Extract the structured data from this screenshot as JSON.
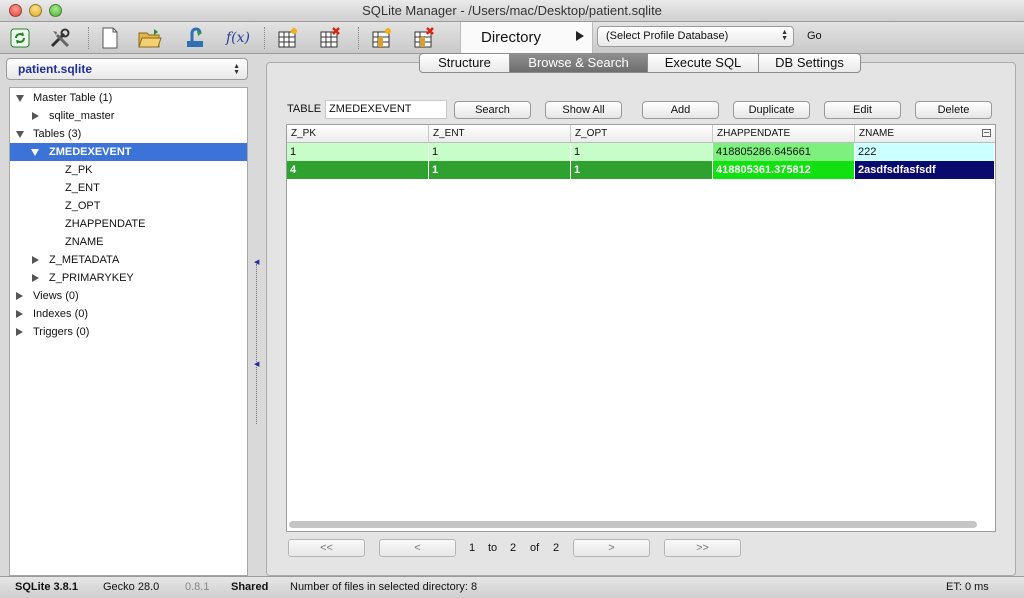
{
  "window": {
    "title": "SQLite Manager - /Users/mac/Desktop/patient.sqlite"
  },
  "toolbar": {
    "icons": [
      "refresh-icon",
      "tools-icon",
      "new-database-icon",
      "open-database-icon",
      "connect-icon",
      "function-icon",
      "create-table-icon",
      "drop-table-icon",
      "create-index-icon",
      "drop-index-icon"
    ],
    "function_label": "f(x)",
    "directory_label": "Directory",
    "profile_select": "(Select Profile Database)",
    "go_label": "Go"
  },
  "sidebar": {
    "database": "patient.sqlite",
    "tree": [
      {
        "label": "Master Table (1)",
        "state": "open"
      },
      {
        "label": "sqlite_master",
        "state": "closed"
      },
      {
        "label": "Tables (3)",
        "state": "open"
      },
      {
        "label": "ZMEDEXEVENT",
        "state": "open",
        "selected": true
      },
      {
        "label": "Z_PK"
      },
      {
        "label": "Z_ENT"
      },
      {
        "label": "Z_OPT"
      },
      {
        "label": "ZHAPPENDATE"
      },
      {
        "label": "ZNAME"
      },
      {
        "label": "Z_METADATA",
        "state": "closed"
      },
      {
        "label": "Z_PRIMARYKEY",
        "state": "closed"
      },
      {
        "label": "Views (0)",
        "state": "closed"
      },
      {
        "label": "Indexes (0)",
        "state": "closed"
      },
      {
        "label": "Triggers (0)",
        "state": "closed"
      }
    ]
  },
  "tabs": {
    "structure": "Structure",
    "browse": "Browse & Search",
    "execute": "Execute SQL",
    "settings": "DB Settings"
  },
  "browse": {
    "table_label": "TABLE",
    "table_name": "ZMEDEXEVENT",
    "buttons": {
      "search": "Search",
      "show_all": "Show All",
      "add": "Add",
      "duplicate": "Duplicate",
      "edit": "Edit",
      "delete": "Delete"
    },
    "columns": [
      "Z_PK",
      "Z_ENT",
      "Z_OPT",
      "ZHAPPENDATE",
      "ZNAME"
    ],
    "rows": [
      [
        "1",
        "1",
        "1",
        "418805286.645661",
        "222"
      ],
      [
        "4",
        "1",
        "1",
        "418805361.375812",
        "2asdfsdfasfsdf"
      ]
    ],
    "colors": {
      "row1_bg": "#c8fcc8",
      "row1_date_bg": "#7ef07e",
      "row1_name_bg": "#ccffff",
      "row2_bg": "#2fa12f",
      "row2_date_bg": "#11e011",
      "row2_name_bg": "#0a0a6e"
    }
  },
  "pager": {
    "first": "<<",
    "prev": "<",
    "next": ">",
    "last": ">>",
    "from": "1",
    "to_word": "to",
    "to": "2",
    "of_word": "of",
    "total": "2"
  },
  "status": {
    "sqlite_version": "SQLite 3.8.1",
    "gecko_version": "Gecko 28.0",
    "ext_version": "0.8.1",
    "mode": "Shared",
    "files_message": "Number of files in selected directory: 8",
    "elapsed": "ET: 0 ms"
  }
}
